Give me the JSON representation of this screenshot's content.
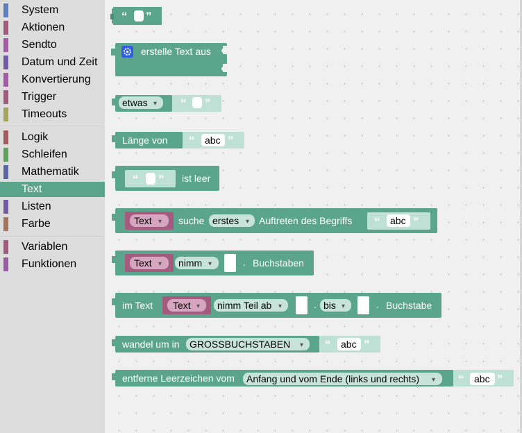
{
  "toolbox": {
    "categories": [
      {
        "label": "System",
        "color": "#5b7fbf"
      },
      {
        "label": "Aktionen",
        "color": "#a55b80"
      },
      {
        "label": "Sendto",
        "color": "#a55ba5"
      },
      {
        "label": "Datum und Zeit",
        "color": "#745ba5"
      },
      {
        "label": "Konvertierung",
        "color": "#a55ba5"
      },
      {
        "label": "Trigger",
        "color": "#a55b80"
      },
      {
        "label": "Timeouts",
        "color": "#a5a55b"
      },
      {
        "label": "Logik",
        "color": "#a55b5b"
      },
      {
        "label": "Schleifen",
        "color": "#5ba55b"
      },
      {
        "label": "Mathematik",
        "color": "#5b67a5"
      },
      {
        "label": "Text",
        "color": "#5ba58c",
        "selected": true
      },
      {
        "label": "Listen",
        "color": "#745ba5"
      },
      {
        "label": "Farbe",
        "color": "#a5745b"
      },
      {
        "label": "Variablen",
        "color": "#a55b80"
      },
      {
        "label": "Funktionen",
        "color": "#995ba5"
      }
    ]
  },
  "blocks": {
    "create_text": "erstelle Text aus",
    "append_var": "etwas",
    "length_of": "Länge von",
    "length_value": "abc",
    "is_empty": "ist leer",
    "indexof_var": "Text",
    "indexof_search": "suche",
    "indexof_mode": "erstes",
    "indexof_suffix": "Auftreten des Begriffs",
    "indexof_value": "abc",
    "charat_var": "Text",
    "charat_mode": "nimm",
    "charat_dot": ".",
    "charat_suffix": "Buchstaben",
    "substring_prefix": "im Text",
    "substring_var": "Text",
    "substring_mode": "nimm Teil ab",
    "substring_dot": ".",
    "substring_to": "bis",
    "substring_dot2": ".",
    "substring_suffix": "Buchstabe",
    "changecase_prefix": "wandel um in",
    "changecase_mode": "GROSSBUCHSTABEN",
    "changecase_value": "abc",
    "trim_prefix": "entferne Leerzeichen vom",
    "trim_mode": "Anfang und vom Ende (links und rechts)",
    "trim_value": "abc",
    "quote_open": "“",
    "quote_close": "”",
    "dropdown_arrow": "▾"
  },
  "colors": {
    "text_block": "#5ba58c",
    "text_block_dark": "#4a8e77",
    "shadow_block": "#bfe0d4",
    "variable_block": "#a55b80",
    "selected_category": "#5ba58c",
    "gear_icon": "#2f5fe0"
  }
}
